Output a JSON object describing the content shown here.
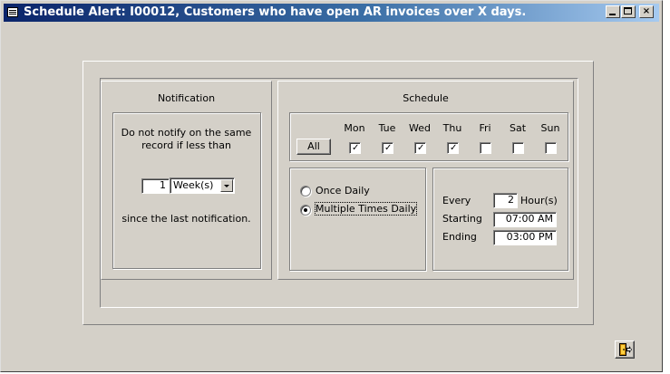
{
  "window": {
    "title": "Schedule Alert: I00012, Customers who have open AR invoices over X days.",
    "controls": {
      "minimize": "_",
      "maximize": "□",
      "close": "×"
    }
  },
  "notification": {
    "heading": "Notification",
    "line1": "Do not notify on the same",
    "line2": "record if less than",
    "count_value": "1",
    "unit_value": "Week(s)",
    "since_text": "since the last notification."
  },
  "schedule": {
    "heading": "Schedule",
    "all_button": "All",
    "days": [
      {
        "label": "Mon",
        "checked": true
      },
      {
        "label": "Tue",
        "checked": true
      },
      {
        "label": "Wed",
        "checked": true
      },
      {
        "label": "Thu",
        "checked": true
      },
      {
        "label": "Fri",
        "checked": false
      },
      {
        "label": "Sat",
        "checked": false
      },
      {
        "label": "Sun",
        "checked": false
      }
    ],
    "frequency": {
      "once_label": "Once Daily",
      "multiple_label": "Multiple Times Daily",
      "selected": "multiple"
    },
    "times": {
      "every_label": "Every",
      "every_value": "2",
      "every_unit": "Hour(s)",
      "starting_label": "Starting",
      "starting_value": "07:00 AM",
      "ending_label": "Ending",
      "ending_value": "03:00 PM"
    }
  },
  "footer": {
    "exit_icon": "door-exit-icon"
  }
}
